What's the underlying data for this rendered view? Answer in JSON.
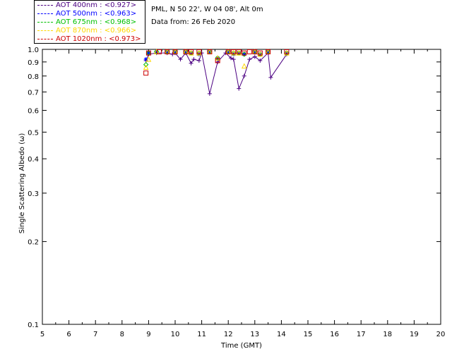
{
  "info": {
    "site": "PML, N 50 22', W 04 08', Alt 0m",
    "date": "Data from: 26 Feb 2020"
  },
  "legend": [
    {
      "label": "AOT  400nm : <0.927>",
      "color": "#4b0082"
    },
    {
      "label": "AOT  500nm : <0.963>",
      "color": "#0000ff"
    },
    {
      "label": "AOT  675nm : <0.968>",
      "color": "#00c000"
    },
    {
      "label": "AOT  870nm : <0.966>",
      "color": "#ffd700"
    },
    {
      "label": "AOT 1020nm : <0.973>",
      "color": "#cc0000"
    }
  ],
  "chart_data": {
    "type": "scatter",
    "xlabel": "Time (GMT)",
    "ylabel": "Single Scattering Albedo (ω)",
    "xlim": [
      5,
      20
    ],
    "ylim": [
      0.1,
      1.0
    ],
    "yscale": "log",
    "xticks": [
      "5",
      "6",
      "7",
      "8",
      "9",
      "10",
      "11",
      "12",
      "13",
      "14",
      "15",
      "16",
      "17",
      "18",
      "19",
      "20"
    ],
    "yticks": [
      "0.1",
      "0.2",
      "0.3",
      "0.4",
      "0.5",
      "0.6",
      "0.7",
      "0.8",
      "0.9",
      "1.0"
    ],
    "series": [
      {
        "name": "AOT  400nm",
        "color": "#4b0082",
        "marker": "plus",
        "connected": true,
        "x": [
          8.9,
          9.0,
          9.3,
          9.7,
          9.9,
          10.0,
          10.2,
          10.4,
          10.6,
          10.7,
          10.9,
          11.0,
          11.3,
          11.6,
          11.9,
          12.1,
          12.2,
          12.4,
          12.6,
          12.8,
          13.0,
          13.2,
          13.5,
          13.6,
          14.2
        ],
        "y": [
          0.91,
          0.96,
          0.97,
          0.97,
          0.96,
          0.97,
          0.92,
          0.97,
          0.89,
          0.92,
          0.91,
          0.97,
          0.69,
          0.9,
          0.97,
          0.93,
          0.92,
          0.72,
          0.8,
          0.92,
          0.94,
          0.91,
          0.97,
          0.79,
          0.96
        ]
      },
      {
        "name": "AOT  500nm",
        "color": "#0000ff",
        "marker": "star",
        "connected": false,
        "x": [
          8.9,
          9.0,
          9.3,
          9.7,
          10.0,
          10.4,
          10.6,
          10.9,
          11.3,
          11.6,
          12.0,
          12.2,
          12.4,
          12.6,
          13.0,
          13.2,
          13.5,
          14.2
        ],
        "y": [
          0.92,
          0.97,
          0.98,
          0.98,
          0.98,
          0.98,
          0.97,
          0.96,
          0.98,
          0.93,
          0.98,
          0.96,
          0.97,
          0.96,
          0.98,
          0.96,
          0.98,
          0.97
        ]
      },
      {
        "name": "AOT  675nm",
        "color": "#00c000",
        "marker": "diamond",
        "connected": false,
        "x": [
          8.9,
          9.0,
          9.3,
          9.7,
          10.0,
          10.4,
          10.6,
          10.9,
          11.3,
          11.6,
          12.0,
          12.2,
          12.4,
          12.6,
          13.0,
          13.2,
          13.5,
          14.2
        ],
        "y": [
          0.88,
          0.97,
          0.98,
          0.98,
          0.98,
          0.98,
          0.97,
          0.97,
          0.98,
          0.93,
          0.98,
          0.97,
          0.97,
          0.96,
          0.98,
          0.96,
          0.98,
          0.97
        ]
      },
      {
        "name": "AOT  870nm",
        "color": "#ffd700",
        "marker": "triangle",
        "connected": false,
        "x": [
          8.9,
          9.0,
          9.3,
          9.7,
          10.0,
          10.4,
          10.6,
          10.9,
          11.3,
          11.6,
          12.0,
          12.2,
          12.4,
          12.6,
          13.0,
          13.2,
          13.5,
          14.2
        ],
        "y": [
          0.86,
          0.92,
          0.98,
          0.98,
          0.98,
          0.98,
          0.97,
          0.97,
          0.98,
          0.93,
          0.98,
          0.97,
          0.97,
          0.87,
          0.98,
          0.96,
          0.98,
          0.97
        ]
      },
      {
        "name": "AOT 1020nm",
        "color": "#cc0000",
        "marker": "square",
        "connected": false,
        "x": [
          8.9,
          9.0,
          9.4,
          9.7,
          10.0,
          10.4,
          10.6,
          10.9,
          11.3,
          11.6,
          12.0,
          12.2,
          12.4,
          12.6,
          12.8,
          13.0,
          13.2,
          13.5,
          14.2
        ],
        "y": [
          0.82,
          0.97,
          0.98,
          0.98,
          0.98,
          0.98,
          0.98,
          0.98,
          0.98,
          0.91,
          0.98,
          0.98,
          0.98,
          0.97,
          0.98,
          0.98,
          0.97,
          0.98,
          0.98
        ]
      }
    ]
  }
}
